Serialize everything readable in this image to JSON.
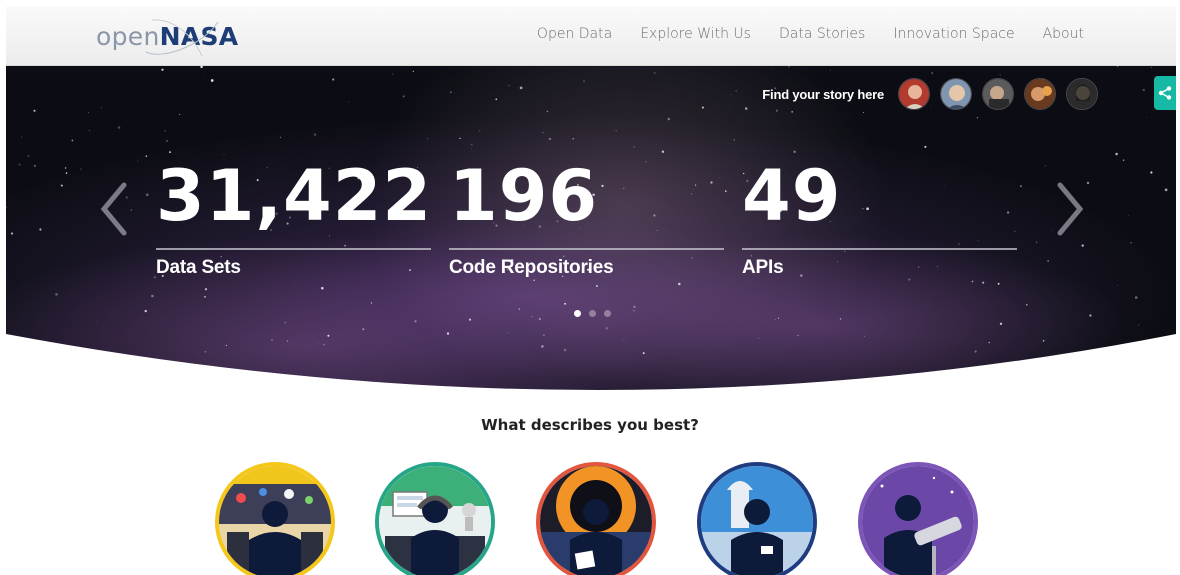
{
  "header": {
    "logo": {
      "open": "open",
      "nasa": "NASA"
    },
    "nav": [
      "Open Data",
      "Explore With Us",
      "Data Stories",
      "Innovation Space",
      "About"
    ]
  },
  "hero": {
    "story_label": "Find your story here",
    "stats": [
      {
        "value": "31,422",
        "label": "Data Sets"
      },
      {
        "value": "196",
        "label": "Code Repositories"
      },
      {
        "value": "49",
        "label": "APIs"
      }
    ],
    "carousel_active": 1,
    "carousel_count": 3
  },
  "personas": {
    "question": "What describes you best?"
  },
  "colors": {
    "nasa_blue": "#1e3d77",
    "share_teal": "#16b9a4",
    "persona_yellow": "#f4c71a",
    "persona_green": "#27a589",
    "persona_red": "#e2563f",
    "persona_navy": "#1f3c80",
    "persona_purple": "#7d54b7"
  }
}
